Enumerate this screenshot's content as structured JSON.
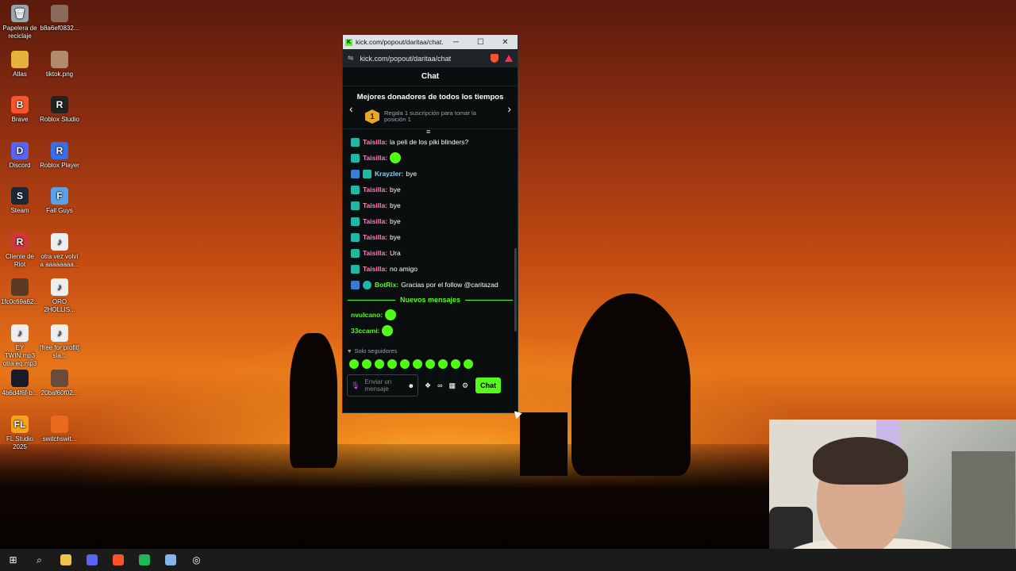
{
  "desktop": {
    "icons": [
      {
        "label": "Papelera de reciclaje",
        "color": "#9aa4b0",
        "glyph": "🗑"
      },
      {
        "label": "b8a6ef0832...",
        "color": "#8a6b5a",
        "glyph": ""
      },
      {
        "label": "Atlas",
        "color": "#e6b23a",
        "glyph": ""
      },
      {
        "label": "tiktok.png",
        "color": "#b08a6a",
        "glyph": ""
      },
      {
        "label": "Brave",
        "color": "#fb542b",
        "glyph": "B"
      },
      {
        "label": "Roblox Studio",
        "color": "#222222",
        "glyph": "R"
      },
      {
        "label": "Discord",
        "color": "#5865f2",
        "glyph": "D"
      },
      {
        "label": "Roblox Player",
        "color": "#3a6ee8",
        "glyph": "R"
      },
      {
        "label": "Steam",
        "color": "#1b2838",
        "glyph": "S"
      },
      {
        "label": "Fall Guys",
        "color": "#5aa0e8",
        "glyph": "F"
      },
      {
        "label": "Cliente de Riot",
        "color": "#d13639",
        "glyph": "R"
      },
      {
        "label": "otra vez volví a aaaaaaaa...",
        "color": "#eeeeee",
        "glyph": "♪"
      },
      {
        "label": "1fc0c69a62...",
        "color": "#5a3a20",
        "glyph": ""
      },
      {
        "label": "ORO 2HOLLIS...",
        "color": "#eeeeee",
        "glyph": "♪"
      },
      {
        "label": "EY TWIN.mp3 otra eq.mp3",
        "color": "#eeeeee",
        "glyph": "♪"
      },
      {
        "label": "[free for profit] sla...",
        "color": "#eeeeee",
        "glyph": "♪"
      },
      {
        "label": "4b6d4f6f-b...",
        "color": "#1a1a2a",
        "glyph": ""
      },
      {
        "label": "20baf60f02...",
        "color": "#6a4a3a",
        "glyph": ""
      },
      {
        "label": "FL Studio 2025",
        "color": "#f6a21a",
        "glyph": "FL"
      },
      {
        "label": "switchswit...",
        "color": "#e86a1a",
        "glyph": ""
      }
    ]
  },
  "window": {
    "title": "kick.com/popout/daritaa/chat...",
    "url": "kick.com/popout/daritaa/chat",
    "minimize": "─",
    "maximize": "☐",
    "close": "✕"
  },
  "chat": {
    "header": "Chat",
    "donors_title": "Mejores donadores de todos los tiempos",
    "donors_rank": "1",
    "donors_text": "Regala 1 suscripción para tomar la posición 1",
    "messages": [
      {
        "user": "Taisilla",
        "color": "#ff7eb6",
        "text": "la peli de los piki blinders?",
        "badges": [
          "sub"
        ],
        "emote": false
      },
      {
        "user": "Taisilla",
        "color": "#ff7eb6",
        "text": "",
        "badges": [
          "sub"
        ],
        "emote": true
      },
      {
        "user": "Krayzler",
        "color": "#7fd3ff",
        "text": "bye",
        "badges": [
          "mod",
          "sub"
        ],
        "emote": false
      },
      {
        "user": "Taisilla",
        "color": "#ff7eb6",
        "text": "bye",
        "badges": [
          "sub"
        ],
        "emote": false
      },
      {
        "user": "Taisilla",
        "color": "#ff7eb6",
        "text": "bye",
        "badges": [
          "sub"
        ],
        "emote": false
      },
      {
        "user": "Taisilla",
        "color": "#ff7eb6",
        "text": "bye",
        "badges": [
          "sub"
        ],
        "emote": false
      },
      {
        "user": "Taisilla",
        "color": "#ff7eb6",
        "text": "bye",
        "badges": [
          "sub"
        ],
        "emote": false
      },
      {
        "user": "Taisilla",
        "color": "#ff7eb6",
        "text": "Ura",
        "badges": [
          "sub"
        ],
        "emote": false
      },
      {
        "user": "Taisilla",
        "color": "#ff7eb6",
        "text": "no amigo",
        "badges": [
          "sub"
        ],
        "emote": false
      },
      {
        "user": "BotRix",
        "color": "#53fc18",
        "text": "Gracias por el follow @caritazad",
        "badges": [
          "mod",
          "bot"
        ],
        "emote": false
      }
    ],
    "new_messages_label": "Nuevos mensajes",
    "new_messages": [
      {
        "user": "nvulcano",
        "color": "#53fc18",
        "text": "",
        "emote": true
      },
      {
        "user": "33ccami",
        "color": "#53fc18",
        "text": "",
        "emote": true
      }
    ],
    "followers_only": "Solo seguidores",
    "input_placeholder": "Enviar un mensaje",
    "send_label": "Chat"
  },
  "taskbar": {
    "items": [
      {
        "name": "start",
        "glyph": "⊞",
        "color": "#ffffff"
      },
      {
        "name": "search",
        "glyph": "⌕",
        "color": "#ffffff"
      },
      {
        "name": "file-explorer",
        "glyph": "",
        "color": "#f2c24a"
      },
      {
        "name": "discord",
        "glyph": "",
        "color": "#5865f2"
      },
      {
        "name": "brave",
        "glyph": "",
        "color": "#fb542b"
      },
      {
        "name": "spotify",
        "glyph": "",
        "color": "#1db954"
      },
      {
        "name": "notepad",
        "glyph": "",
        "color": "#7fb8e8"
      },
      {
        "name": "obs",
        "glyph": "◎",
        "color": "#ffffff"
      }
    ]
  }
}
